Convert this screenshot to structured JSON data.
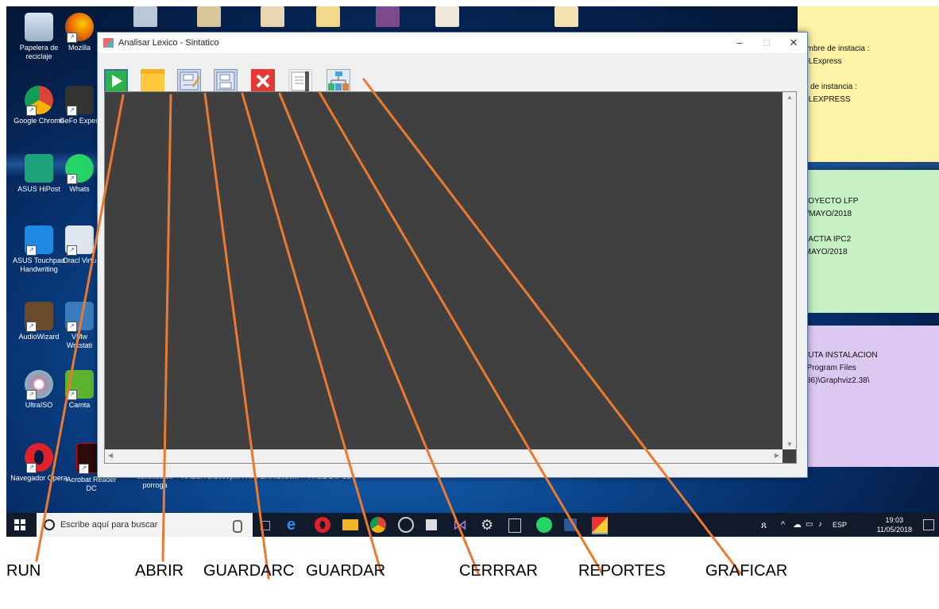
{
  "window": {
    "title": "Analisar Lexico - Sintatico",
    "minimize": "–",
    "maximize": "□",
    "close": "✕"
  },
  "toolbar": [
    {
      "name": "run",
      "icon": "play-icon",
      "color": "#2db34a"
    },
    {
      "name": "abrir",
      "icon": "folder-icon",
      "color": "#ffc83d"
    },
    {
      "name": "guardarc",
      "icon": "save-as-icon",
      "color": "#9fb7d8"
    },
    {
      "name": "guardar",
      "icon": "save-icon",
      "color": "#9fb7d8"
    },
    {
      "name": "cerrrar",
      "icon": "close-icon",
      "color": "#e53935"
    },
    {
      "name": "reportes",
      "icon": "report-icon",
      "color": "#9aa3ad"
    },
    {
      "name": "graficar",
      "icon": "graph-icon",
      "color": "#4aa0d8"
    }
  ],
  "desktop_icons": {
    "col1": [
      "Papelera de reciclaje",
      "Google Chrome",
      "ASUS HiPost",
      "ASUS Touchpad Handwriting",
      "AudioWizard",
      "UltraISO",
      "Navegador Opera"
    ],
    "col2": [
      "Mozilla",
      "GeFo Experi",
      "Whats",
      "Oracl Virtu",
      "VMw Wrkstati",
      "Camta",
      "Acrobat Reader DC"
    ],
    "bottom_row": [
      "solicitud de porroga",
      "RABBITS.1080p...",
      "PANTERA.1080...",
      "FASE 2 IPC2"
    ]
  },
  "sticky_notes": [
    {
      "color": "#fdf3a6",
      "text": "ombre de instacia :\nQLExpress\n\nD de instancia :\nQLEXPRESS"
    },
    {
      "color": "#c6efc3",
      "text": "ROYECTO LFP\n1/MAYO/2018\n\nRACTIA IPC2\n/MAYO/2018"
    },
    {
      "color": "#dcc8f3",
      "text": "RUTA INSTALACION\n:\\Program Files\nx86)\\Graphviz2.38\\"
    }
  ],
  "taskbar": {
    "search_placeholder": "Escribe aquí para buscar",
    "language": "ESP",
    "time": "19:03",
    "date": "11/05/2018"
  },
  "callouts": [
    "RUN",
    "ABRIR",
    "GUARDARC",
    "GUARDAR",
    "CERRRAR",
    "REPORTES",
    "GRAFICAR"
  ],
  "colors": {
    "callout_line": "#ec7a2e",
    "editor_bg": "#404040",
    "taskbar_bg": "#101a2a"
  }
}
